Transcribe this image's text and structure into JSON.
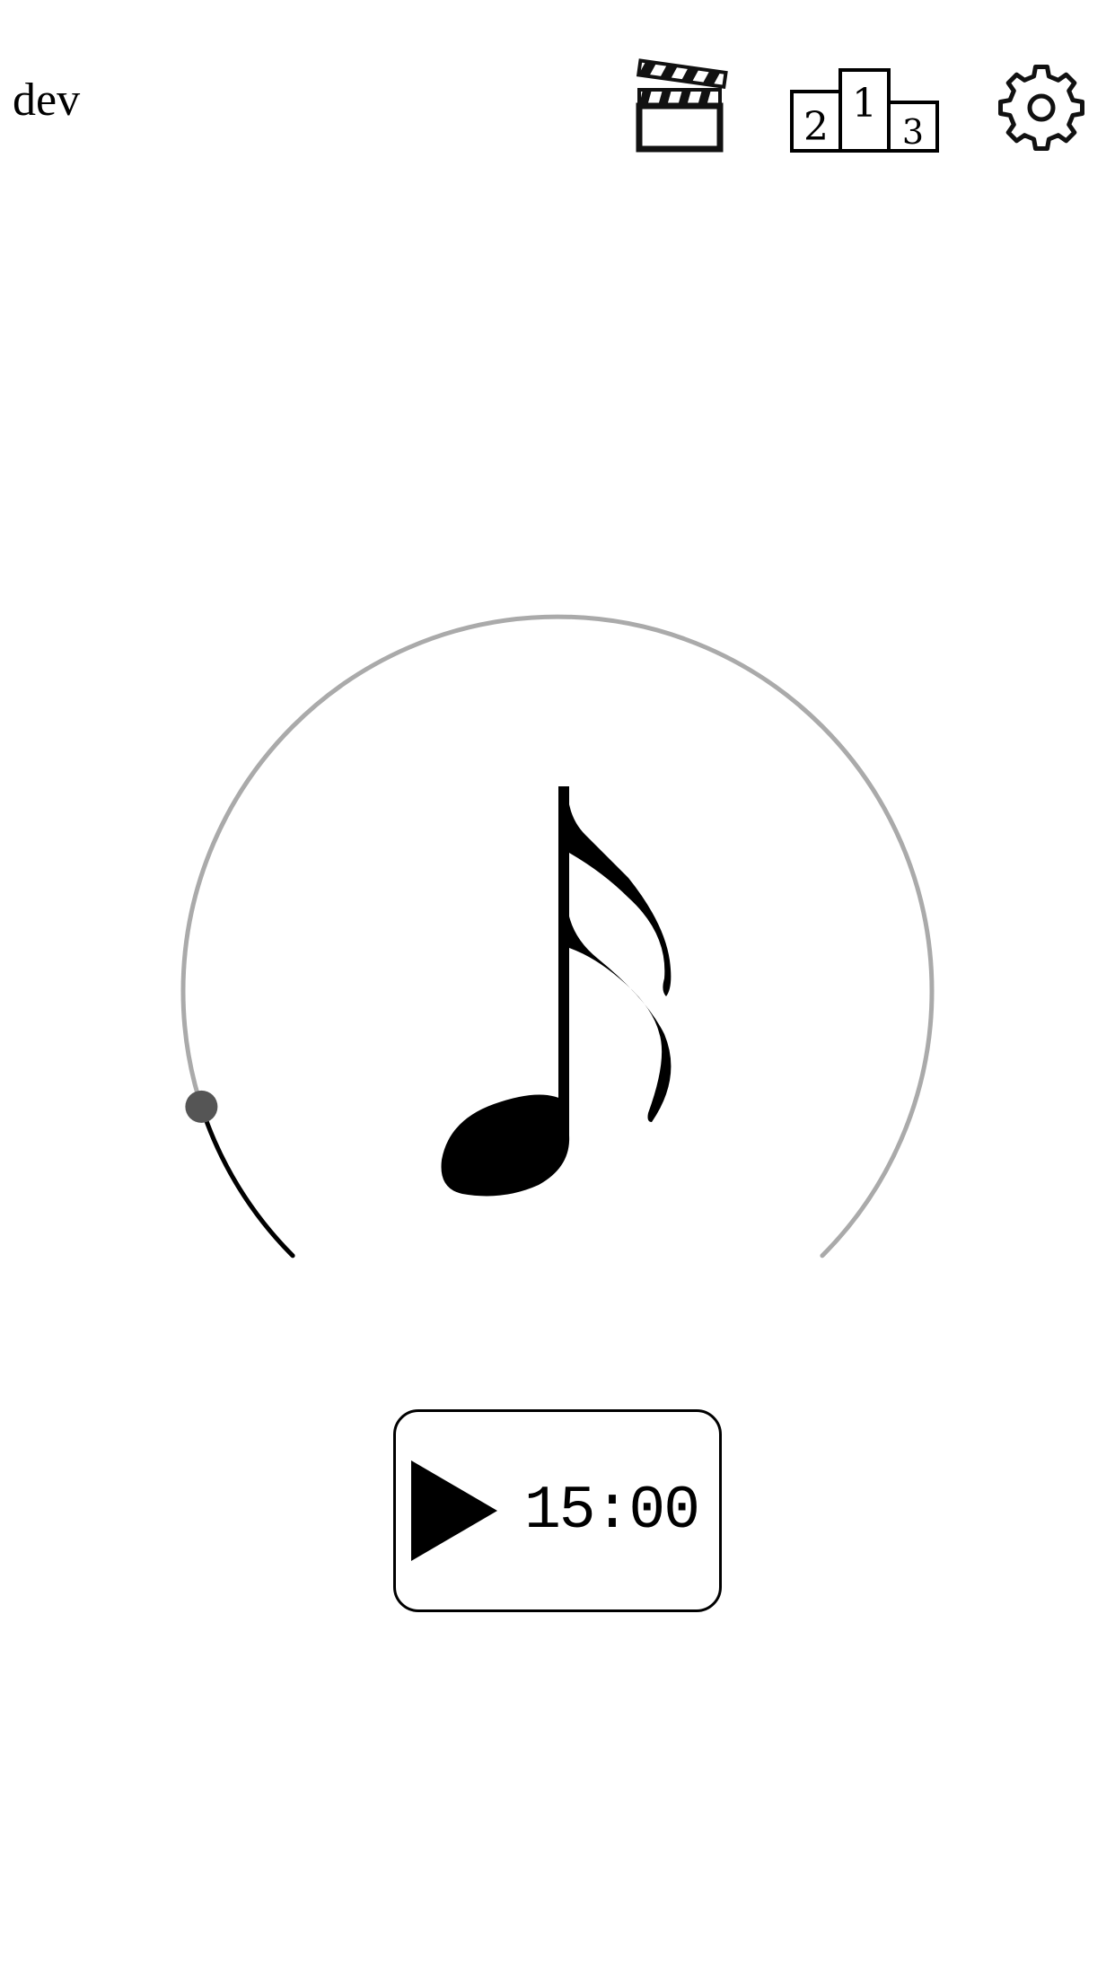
{
  "header": {
    "env_label": "dev",
    "icons": [
      "clapperboard-icon",
      "leaderboard-podium-icon",
      "gear-icon"
    ],
    "podium": {
      "left_place": "2",
      "center_place": "1",
      "right_place": "3"
    }
  },
  "dial": {
    "center_icon": "sixteenth-note-icon",
    "level": 0.1,
    "track_color": "#aaaaaa",
    "progress_color": "#000000",
    "knob_color": "#555555"
  },
  "play_button": {
    "icon": "play-icon",
    "time": "15:00"
  }
}
